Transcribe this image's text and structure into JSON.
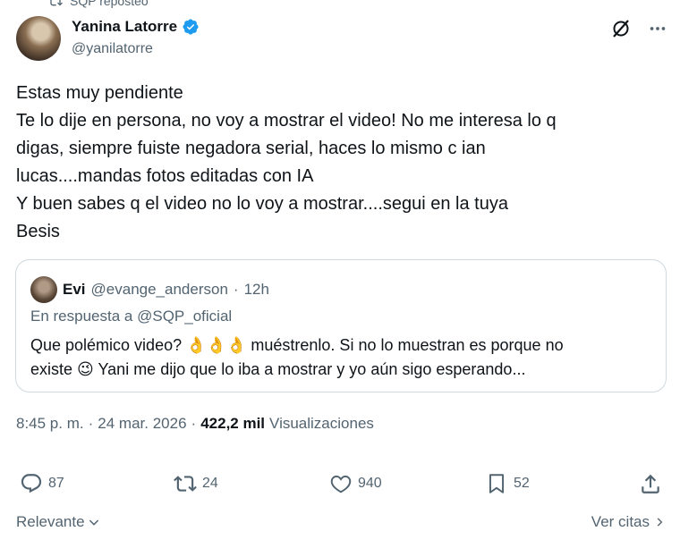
{
  "repost": {
    "label": "SQP reposteó",
    "icon": "repost-icon"
  },
  "author": {
    "name": "Yanina Latorre",
    "handle": "@yanilatorre",
    "verified": true,
    "verified_color": "#1d9bf0"
  },
  "post": {
    "lines": [
      "Estas muy pendiente",
      "Te lo dije en persona, no voy a mostrar el video! No me interesa lo q",
      "digas, siempre fuiste negadora serial, haces lo mismo c ian",
      "lucas....mandas fotos editadas con IA",
      "Y buen sabes q el video no lo voy a mostrar....segui en la tuya",
      "Besis"
    ]
  },
  "quote": {
    "name": "Evi",
    "handle": "@evange_anderson",
    "dot": "·",
    "time": "12h",
    "reply_prefix": "En respuesta a",
    "reply_mention": "@SQP_oficial",
    "text_part1": "Que polémico video?",
    "emojis1": "👌👌👌",
    "text_part2": "muéstrenlo. Si no lo muestran es porque no",
    "text_part3": "existe",
    "emoji2": "😉",
    "text_part4": "Yani me dijo que lo iba a mostrar y yo aún sigo esperando..."
  },
  "meta": {
    "time": "8:45 p. m.",
    "sep1": "·",
    "date": "24 mar. 2026",
    "sep2": "·",
    "views_count": "422,2 mil",
    "views_label": "Visualizaciones"
  },
  "actions": {
    "replies": "87",
    "reposts": "24",
    "likes": "940",
    "bookmarks": "52"
  },
  "footer": {
    "sort_label": "Relevante",
    "quotes_label": "Ver citas"
  },
  "colors": {
    "text": "#0f1419",
    "secondary": "#536471",
    "border": "#cfd9de",
    "accent": "#1d9bf0"
  }
}
